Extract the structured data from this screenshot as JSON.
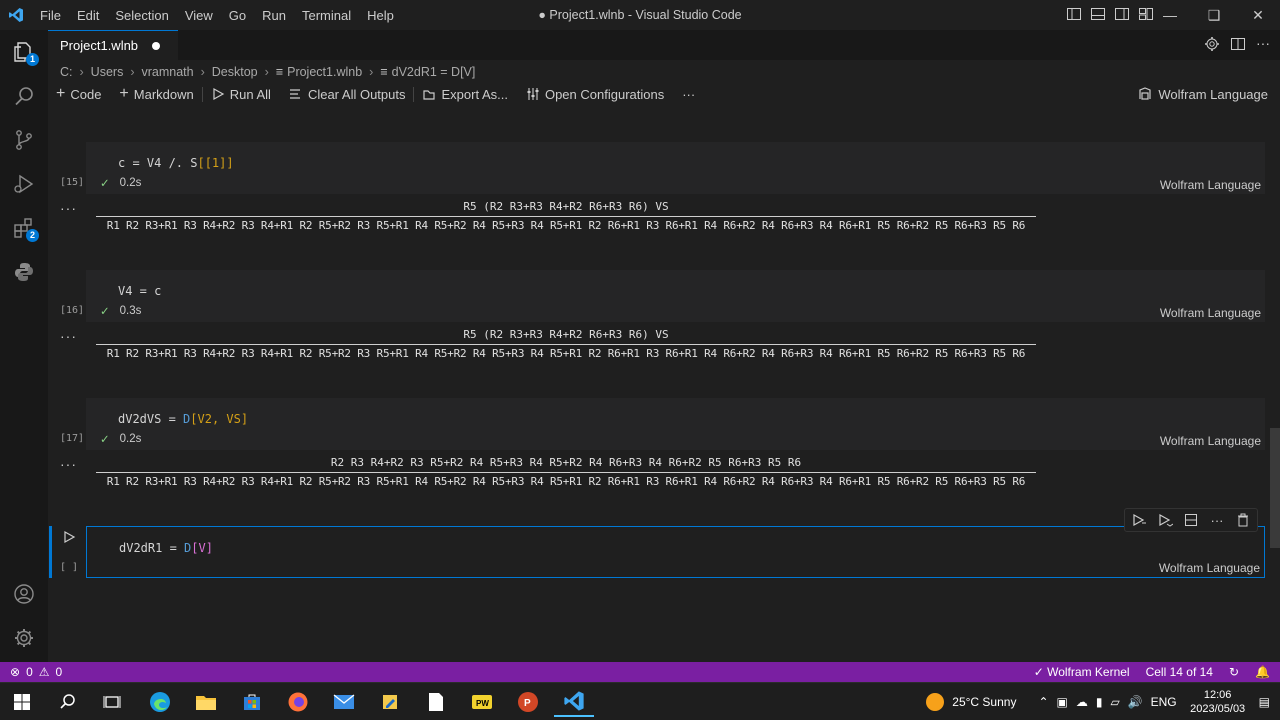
{
  "titlebar": {
    "menu": [
      "File",
      "Edit",
      "Selection",
      "View",
      "Go",
      "Run",
      "Terminal",
      "Help"
    ],
    "window_title": "● Project1.wlnb - Visual Studio Code"
  },
  "activitybar": {
    "explorer_badge": "1",
    "extensions_badge": "2"
  },
  "tab": {
    "label": "Project1.wlnb"
  },
  "breadcrumb": {
    "items": [
      "C:",
      "Users",
      "vramnath",
      "Desktop",
      "Project1.wlnb",
      "dV2dR1 = D[V]"
    ]
  },
  "toolbar": {
    "code": "Code",
    "markdown": "Markdown",
    "run_all": "Run All",
    "clear_outputs": "Clear All Outputs",
    "export": "Export As...",
    "open_config": "Open Configurations",
    "more": "···",
    "kernel": "Wolfram Language"
  },
  "cells": [
    {
      "exec": "[15]",
      "code_a": "c = V4 /. S",
      "code_b": "[[1]]",
      "time": "0.2s",
      "lang": "Wolfram Language",
      "out_num": "R5 (R2 R3+R3 R4+R2 R6+R3 R6) VS",
      "out_den": "R1 R2 R3+R1 R3 R4+R2 R3 R4+R1 R2 R5+R2 R3 R5+R1 R4 R5+R2 R4 R5+R3 R4 R5+R1 R2 R6+R1 R3 R6+R1 R4 R6+R2 R4 R6+R3 R4 R6+R1 R5 R6+R2 R5 R6+R3 R5 R6"
    },
    {
      "exec": "[16]",
      "code_a": "V4 = c",
      "code_b": "",
      "time": "0.3s",
      "lang": "Wolfram Language",
      "out_num": "R5 (R2 R3+R3 R4+R2 R6+R3 R6) VS",
      "out_den": "R1 R2 R3+R1 R3 R4+R2 R3 R4+R1 R2 R5+R2 R3 R5+R1 R4 R5+R2 R4 R5+R3 R4 R5+R1 R2 R6+R1 R3 R6+R1 R4 R6+R2 R4 R6+R3 R4 R6+R1 R5 R6+R2 R5 R6+R3 R5 R6"
    },
    {
      "exec": "[17]",
      "code_a": "dV2dVS = ",
      "code_fn": "D",
      "code_b": "[V2, VS]",
      "time": "0.2s",
      "lang": "Wolfram Language",
      "out_num": "R2 R3 R4+R2 R3 R5+R2 R4 R5+R3 R4 R5+R2 R4 R6+R3 R4 R6+R2 R5 R6+R3 R5 R6",
      "out_den": "R1 R2 R3+R1 R3 R4+R2 R3 R4+R1 R2 R5+R2 R3 R5+R1 R4 R5+R2 R4 R5+R3 R4 R5+R1 R2 R6+R1 R3 R6+R1 R4 R6+R2 R4 R6+R3 R4 R6+R1 R5 R6+R2 R5 R6+R3 R5 R6"
    },
    {
      "exec": "[ ]",
      "code_a": "dV2dR1 = ",
      "code_fn": "D",
      "code_b": "[V]",
      "lang": "Wolfram Language"
    }
  ],
  "output_menu": "···",
  "statusbar": {
    "errors": "0",
    "warnings": "0",
    "kernel": "Wolfram Kernel",
    "cell": "Cell 14 of 14"
  },
  "taskbar": {
    "weather": "25°C  Sunny",
    "lang": "ENG",
    "time": "12:06",
    "date": "2023/05/03"
  },
  "colors": {
    "accent": "#0078d4",
    "statusbar": "#7a1fa2"
  }
}
